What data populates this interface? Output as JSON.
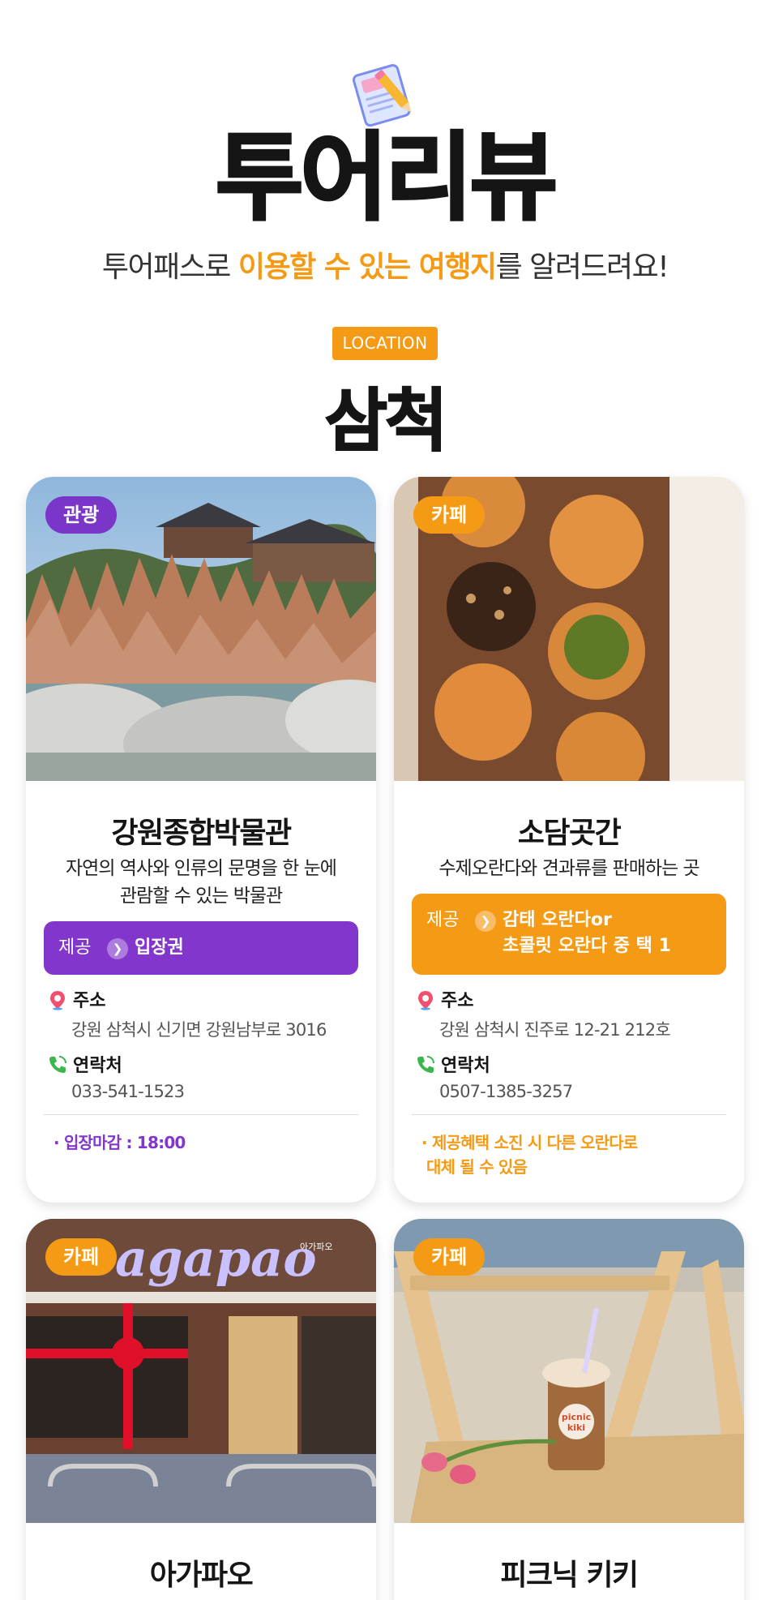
{
  "header": {
    "icon": "notepad-pencil-icon",
    "title": "투어리뷰",
    "subtitle_parts": [
      "투어패스로 ",
      "이용할 수 있는 여행지",
      "를 알려드려요!"
    ]
  },
  "location": {
    "badge": "LOCATION",
    "city": "삼척"
  },
  "colors": {
    "accent_orange": "#f59a14",
    "accent_purple": "#8236cc"
  },
  "cards": [
    {
      "tag": "관광",
      "name": "강원종합박물관",
      "desc_lines": [
        "자연의 역사와 인류의 문명을 한 눈에",
        "관람할 수 있는 박물관"
      ],
      "offer_label": "제공",
      "offer_lines": [
        "입장권"
      ],
      "address_label": "주소",
      "address": "강원 삼척시 신기면 강원남부로 3016",
      "contact_label": "연락처",
      "contact": "033-541-1523",
      "note_lines": [
        "· 입장마감 : 18:00"
      ]
    },
    {
      "tag": "카페",
      "name": "소담곳간",
      "desc_lines": [
        "수제오란다와 견과류를 판매하는 곳"
      ],
      "offer_label": "제공",
      "offer_lines": [
        "감태 오란다or",
        "초콜릿 오란다 중 택 1"
      ],
      "address_label": "주소",
      "address": "강원 삼척시 진주로 12-21 212호",
      "contact_label": "연락처",
      "contact": "0507-1385-3257",
      "note_lines": [
        "· 제공혜택 소진 시 다른 오란다로",
        "대체 될 수 있음"
      ]
    },
    {
      "tag": "카페",
      "name": "아가파오",
      "sign_text": "agapao",
      "sign_small": "아가파오"
    },
    {
      "tag": "카페",
      "name": "피크닉 키키",
      "cup_text": [
        "picnic",
        "kiki"
      ]
    }
  ]
}
